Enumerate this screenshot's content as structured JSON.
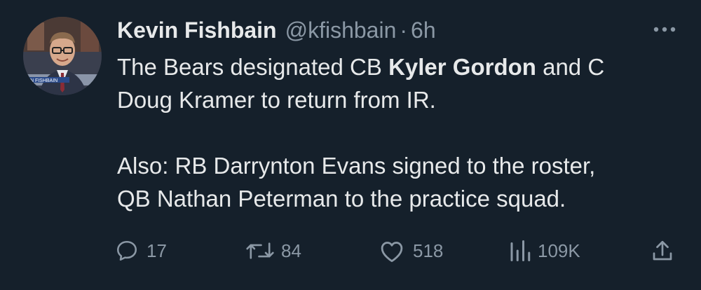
{
  "tweet": {
    "author_name": "Kevin Fishbain",
    "handle": "@kfishbain",
    "separator": "·",
    "time": "6h",
    "avatar_caption": "IN FISHBAIN",
    "text": {
      "line1_pre": "The Bears designated CB ",
      "line1_bold": "Kyler Gordon",
      "line1_post": " and C",
      "line2": "Doug Kramer to return from IR.",
      "line3": "Also: RB Darrynton Evans signed to the roster,",
      "line4": "QB Nathan Peterman to the practice squad."
    },
    "stats": {
      "replies": "17",
      "retweets": "84",
      "likes": "518",
      "views": "109K"
    },
    "icons": {
      "more": "more-horizontal-icon",
      "reply": "reply-icon",
      "retweet": "retweet-icon",
      "like": "heart-icon",
      "views": "analytics-icon",
      "share": "share-icon"
    },
    "colors": {
      "background": "#15202b",
      "primary_text": "#e7e9ea",
      "secondary_text": "#8b98a5"
    }
  }
}
